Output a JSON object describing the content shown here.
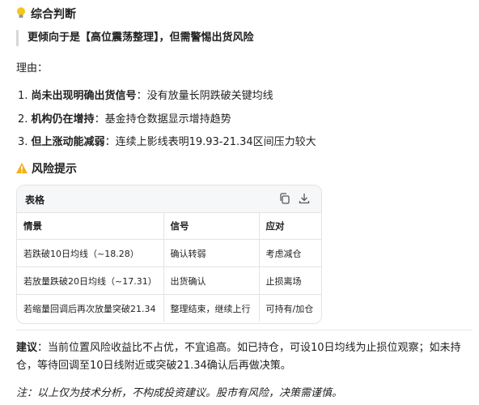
{
  "section_verdict": {
    "icon": "lightbulb-icon",
    "title": "综合判断",
    "quote": "更倾向于是【高位震荡整理】，但需警惕出货风险",
    "reasons_label": "理由：",
    "reasons": [
      {
        "num": "1.",
        "bold": "尚未出现明确出货信号",
        "text": "：没有放量长阴跌破关键均线"
      },
      {
        "num": "2.",
        "bold": "机构仍在增持",
        "text": "：基金持仓数据显示增持趋势"
      },
      {
        "num": "3.",
        "bold": "但上涨动能减弱",
        "text": "：连续上影线表明19.93-21.34区间压力较大"
      }
    ]
  },
  "section_risk": {
    "icon": "warning-icon",
    "title": "风险提示"
  },
  "table": {
    "title": "表格",
    "copy_icon": "copy-icon",
    "download_icon": "download-icon",
    "headers": [
      "情景",
      "信号",
      "应对"
    ],
    "rows": [
      [
        "若跌破10日均线（~18.28）",
        "确认转弱",
        "考虑减仓"
      ],
      [
        "若放量跌破20日均线（~17.31）",
        "出货确认",
        "止损离场"
      ],
      [
        "若缩量回调后再次放量突破21.34",
        "整理结束，继续上行",
        "可持有/加仓"
      ]
    ]
  },
  "advice": {
    "label": "建议",
    "text": "：当前位置风险收益比不占优，不宜追高。如已持仓，可设10日均线为止损位观察；如未持仓，等待回调至10日线附近或突破21.34确认后再做决策。"
  },
  "note": "注：以上仅为技术分析，不构成投资建议。股市有风险，决策需谨慎。",
  "colors": {
    "warning": "#f2b01e",
    "bulb": "#f5c518",
    "border": "#e3e3e3"
  }
}
